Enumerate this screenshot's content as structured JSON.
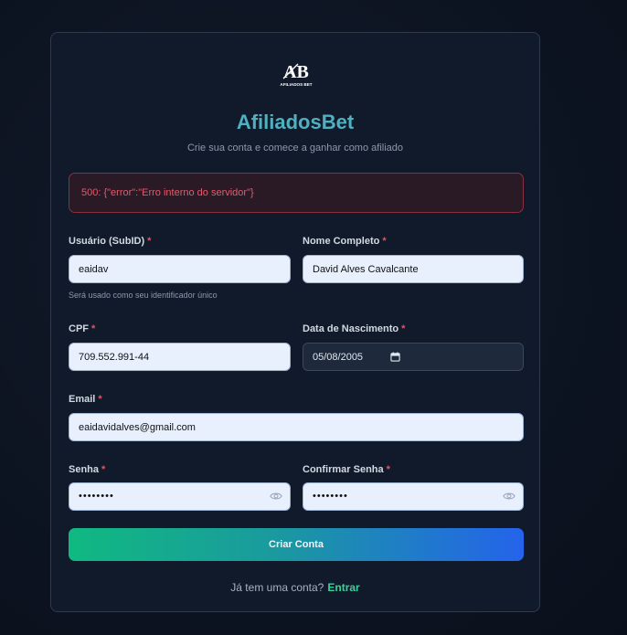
{
  "brand": {
    "logo_text": "AB",
    "logo_subtext": "AFILIADOS BET",
    "title": "AfiliadosBet",
    "subtitle": "Crie sua conta e comece a ganhar como afiliado"
  },
  "error": {
    "message": "500: {\"error\":\"Erro interno do servidor\"}"
  },
  "form": {
    "username": {
      "label": "Usuário (SubID)",
      "required_mark": "*",
      "value": "eaidav",
      "hint": "Será usado como seu identificador único"
    },
    "full_name": {
      "label": "Nome Completo",
      "required_mark": "*",
      "value": "David Alves Cavalcante"
    },
    "cpf": {
      "label": "CPF",
      "required_mark": "*",
      "value": "709.552.991-44"
    },
    "birth_date": {
      "label": "Data de Nascimento",
      "required_mark": "*",
      "value": "05/08/2005"
    },
    "email": {
      "label": "Email",
      "required_mark": "*",
      "value": "eaidavidalves@gmail.com"
    },
    "password": {
      "label": "Senha",
      "required_mark": "*",
      "masked_value": "••••••••"
    },
    "confirm_password": {
      "label": "Confirmar Senha",
      "required_mark": "*",
      "masked_value": "••••••••"
    },
    "submit_label": "Criar Conta"
  },
  "footer": {
    "prompt": "Já tem uma conta?",
    "link_label": "Entrar"
  },
  "colors": {
    "brand_title": "#4fb0c0",
    "error_text": "#e35b6b",
    "link": "#34d399",
    "gradient_start": "#10b981",
    "gradient_end": "#2463eb"
  },
  "icons": {
    "logo": "ab-logo-icon",
    "password_toggle": "eye-icon",
    "date_picker": "calendar-icon"
  }
}
